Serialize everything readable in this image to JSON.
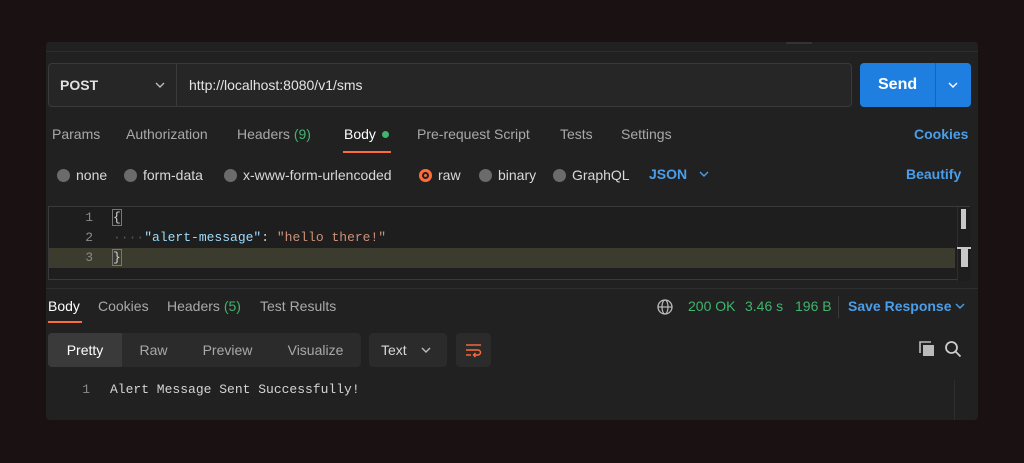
{
  "request": {
    "method": "POST",
    "url": "http://localhost:8080/v1/sms",
    "send_label": "Send"
  },
  "request_tabs": {
    "params": "Params",
    "authorization": "Authorization",
    "headers": "Headers",
    "headers_count": "(9)",
    "body": "Body",
    "prerequest": "Pre-request Script",
    "tests": "Tests",
    "settings": "Settings",
    "cookies": "Cookies"
  },
  "body_types": {
    "none": "none",
    "form_data": "form-data",
    "urlencoded": "x-www-form-urlencoded",
    "raw": "raw",
    "binary": "binary",
    "graphql": "GraphQL",
    "selected": "raw",
    "format": "JSON",
    "beautify": "Beautify"
  },
  "editor": {
    "lines": [
      {
        "num": "1",
        "text": "{"
      },
      {
        "num": "2",
        "key": "\"alert-message\"",
        "colon": ": ",
        "value": "\"hello there!\""
      },
      {
        "num": "3",
        "text": "}"
      }
    ]
  },
  "response": {
    "tabs": {
      "body": "Body",
      "cookies": "Cookies",
      "headers": "Headers",
      "headers_count": "(5)",
      "test_results": "Test Results"
    },
    "status": "200 OK",
    "time": "3.46 s",
    "size": "196 B",
    "save_response": "Save Response",
    "views": {
      "pretty": "Pretty",
      "raw": "Raw",
      "preview": "Preview",
      "visualize": "Visualize"
    },
    "format": "Text",
    "output": [
      {
        "num": "1",
        "text": "Alert Message Sent Successfully!"
      }
    ]
  },
  "colors": {
    "accent": "#ff6c37",
    "link": "#4a9eea",
    "success": "#3fb56d",
    "send": "#1f7fe0"
  }
}
